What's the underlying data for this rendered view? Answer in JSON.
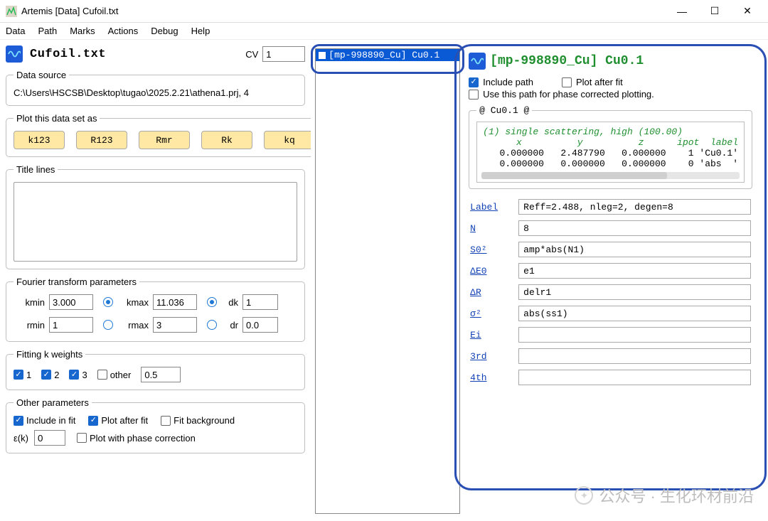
{
  "window": {
    "title": "Artemis [Data] Cufoil.txt"
  },
  "menu": [
    "Data",
    "Path",
    "Marks",
    "Actions",
    "Debug",
    "Help"
  ],
  "left": {
    "file_label": "Cufoil.txt",
    "cv_label": "CV",
    "cv_value": "1",
    "data_source_legend": "Data source",
    "data_source_value": "C:\\Users\\HSCSB\\Desktop\\tugao\\2025.2.21\\athena1.prj, 4",
    "plot_legend": "Plot this data set as",
    "plot_btns": [
      "k123",
      "R123",
      "Rmr",
      "Rk",
      "kq"
    ],
    "title_lines_legend": "Title lines",
    "ft_legend": "Fourier transform parameters",
    "ft": {
      "kmin_l": "kmin",
      "kmin": "3.000",
      "kmax_l": "kmax",
      "kmax": "11.036",
      "dk_l": "dk",
      "dk": "1",
      "rmin_l": "rmin",
      "rmin": "1",
      "rmax_l": "rmax",
      "rmax": "3",
      "dr_l": "dr",
      "dr": "0.0"
    },
    "kw_legend": "Fitting k weights",
    "kw": {
      "l1": "1",
      "l2": "2",
      "l3": "3",
      "other_l": "other",
      "other_v": "0.5"
    },
    "op_legend": "Other parameters",
    "op": {
      "include": "Include in fit",
      "plot_after": "Plot after fit",
      "fit_bg": "Fit background",
      "ek_l": "ε(k)",
      "ek_v": "0",
      "phase": "Plot with phase correction"
    }
  },
  "mid": {
    "item": "[mp-998890_Cu] Cu0.1"
  },
  "right": {
    "title": "[mp-998890_Cu] Cu0.1",
    "include_path": "Include path",
    "plot_after_fit": "Plot after fit",
    "use_phase": "Use this path for phase corrected plotting.",
    "scatter_legend": "@ Cu0.1 @",
    "scatter_top": "(1) single scattering, high (100.00)",
    "scatter_hdr": "      x          y          z      ipot  label",
    "scatter_r1": "   0.000000   2.487790   0.000000    1 'Cu0.1'",
    "scatter_r2": "   0.000000   0.000000   0.000000    0 'abs  '",
    "params": {
      "Label_l": "Label",
      "Label": "Reff=2.488, nleg=2, degen=8",
      "N_l": "N",
      "N": "8",
      "S02_l": "S0²",
      "S02": "amp*abs(N1)",
      "E0_l": "ΔE0",
      "E0": "e1",
      "dR_l": "ΔR",
      "dR": "delr1",
      "ss_l": "σ²",
      "ss": "abs(ss1)",
      "Ei_l": "Ei",
      "Ei": "",
      "third_l": "3rd",
      "third": "",
      "fourth_l": "4th",
      "fourth": ""
    }
  },
  "watermark": "公众号 · 生化环材前沿"
}
